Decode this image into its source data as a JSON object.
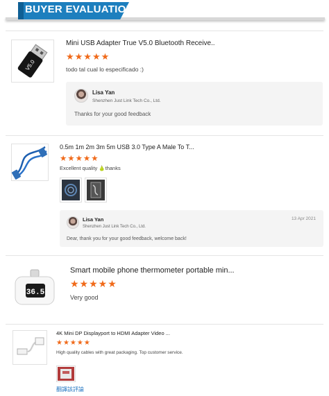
{
  "header": {
    "title": "BUYER EVALUATION"
  },
  "reviews": [
    {
      "product_title": "Mini USB Adapter True V5.0 Bluetooth Receive...",
      "stars": "★★★★★",
      "comment": "todo tal cual lo especificado :)",
      "reply": {
        "name": "Lisa Yan",
        "company": "Shenzhen Just Link Tech Co., Ltd.",
        "text": "Thanks for your good feedback"
      }
    },
    {
      "product_title": "0.5m 1m 2m 3m 5m USB 3.0 Type A Male To T...",
      "stars": "★★★★★",
      "comment": "Excellent quality 🍐thanks",
      "reply": {
        "name": "Lisa Yan",
        "company": "Shenzhen Just Link Tech Co., Ltd.",
        "date": "13 Apr 2021",
        "text": "Dear, thank you for your good feedback, welcome back!"
      }
    },
    {
      "product_title": "Smart mobile phone thermometer portable min...",
      "stars": "★★★★★",
      "comment": "Very good",
      "display_reading": "36.5"
    },
    {
      "product_title": "4K Mini DP Displayport to HDMI Adapter Video ...",
      "stars": "★★★★★",
      "comment": "High quality cables with great packaging. Top customer service.",
      "link": "翻譯該評論"
    }
  ],
  "colors": {
    "accent": "#1d7fbe",
    "stars": "#f06a1a",
    "link": "#2a7bc4",
    "reply_bg": "#f4f4f4"
  }
}
